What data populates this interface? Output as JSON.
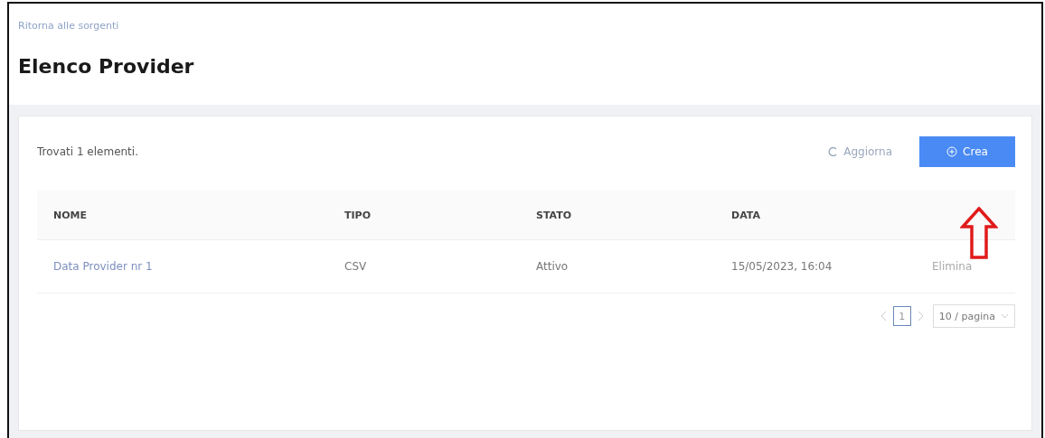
{
  "back_link": "Ritorna alle sorgenti",
  "title": "Elenco Provider",
  "card": {
    "count_text": "Trovati 1 elementi.",
    "refresh_button": "Aggiorna",
    "create_button": "Crea",
    "annotation": {
      "kind": "arrow",
      "color": "#e01b1b"
    },
    "table": {
      "columns": [
        "NOME",
        "TIPO",
        "STATO",
        "DATA"
      ],
      "rows": [
        {
          "name": "Data Provider nr 1",
          "type": "CSV",
          "status": "Attivo",
          "date": "15/05/2023, 16:04",
          "action": {
            "label": "Elimina",
            "disabled": true
          }
        }
      ]
    },
    "pagination": {
      "pages": [
        {
          "label": "1",
          "selected": true
        }
      ],
      "page_size": "10 / pagina"
    }
  }
}
